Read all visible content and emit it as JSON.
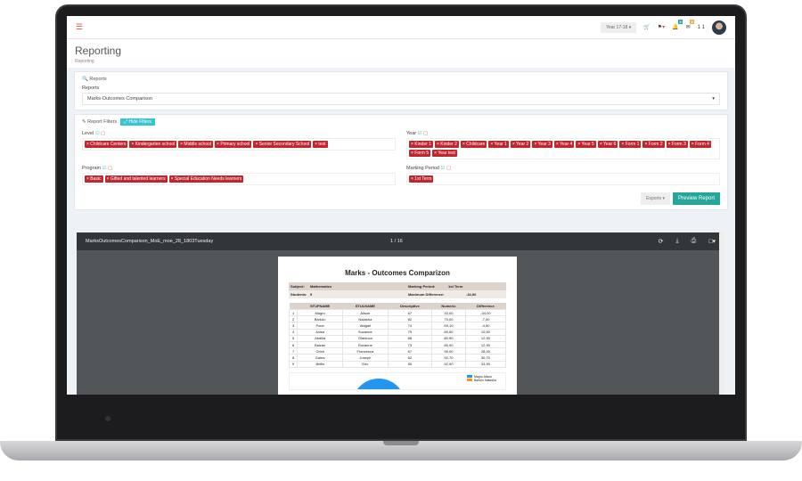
{
  "topbar": {
    "year": "Year 17-18",
    "notif_count": "5",
    "task_count": "3",
    "user_short": "1 1"
  },
  "header": {
    "title": "Reporting",
    "breadcrumb": "Reporting"
  },
  "reports": {
    "legend": "Reports",
    "label": "Reports",
    "selected": "Marks-Outcomes Comparison"
  },
  "filters": {
    "legend": "Report Filters",
    "hide_label": "Hide Filters",
    "level": {
      "label": "Level",
      "tags": [
        "Childcare Centers",
        "Kindergarten school",
        "Middle school",
        "Primary school",
        "Senior Secondary School",
        "test"
      ]
    },
    "year": {
      "label": "Year",
      "tags": [
        "Kinder 1",
        "Kinder 2",
        "Childcare",
        "Year 1",
        "Year 2",
        "Year 3",
        "Year 4",
        "Year 5",
        "Year 6",
        "Form 1",
        "Form 2",
        "Form 3",
        "Form 4",
        "Form 5",
        "Year test"
      ]
    },
    "program": {
      "label": "Program",
      "tags": [
        "Basic",
        "Gifted and talented learners",
        "Special Education Needs learners"
      ]
    },
    "marking": {
      "label": "Marking Period",
      "tags": [
        "1st Term"
      ]
    },
    "exports_label": "Exports",
    "preview_label": "Preview Report"
  },
  "viewer": {
    "filename": "MarksOutcomesComparison_MoE_moe_28_1803Tuesday",
    "page": "1 / 16"
  },
  "doc": {
    "title": "Marks - Outcomes Comparizon",
    "subject_label": "Subject:",
    "subject": "Mathematics",
    "period_label": "Marking Period:",
    "period": "1st Term",
    "students_label": "Students:",
    "students": "9",
    "maxdiff_label": "Maximum Difference:",
    "maxdiff": "-34,00",
    "columns": [
      "",
      "STUFNAME",
      "STULNAME",
      "Descriptive",
      "Numeric",
      "Difference"
    ],
    "rows": [
      [
        "1",
        "Magro",
        "Alison",
        "67",
        "33,00",
        "-34,00"
      ],
      [
        "2",
        "Bartolo",
        "Natasha",
        "82",
        "75,00",
        "-7,00"
      ],
      [
        "3",
        "Pace",
        "Abigail",
        "74",
        "69,10",
        "-4,90"
      ],
      [
        "4",
        "Axisa",
        "Suzanne",
        "79",
        "89,50",
        "10,50"
      ],
      [
        "5",
        "Abdilla",
        "Gianluca",
        "68",
        "80,90",
        "12,90"
      ],
      [
        "6",
        "Balzan",
        "Roxanne",
        "73",
        "85,90",
        "12,90"
      ],
      [
        "7",
        "Grixti",
        "Francesca",
        "67",
        "95,00",
        "28,00"
      ],
      [
        "8",
        "Galea",
        "Joseph",
        "62",
        "92,70",
        "30,70"
      ],
      [
        "9",
        "Briffa",
        "Eric",
        "59",
        "92,90",
        "33,90"
      ]
    ],
    "legend": [
      "Magro Alison",
      "Bartolo Natasha"
    ],
    "legend_colors": [
      "#2196f3",
      "#ff9800"
    ]
  }
}
